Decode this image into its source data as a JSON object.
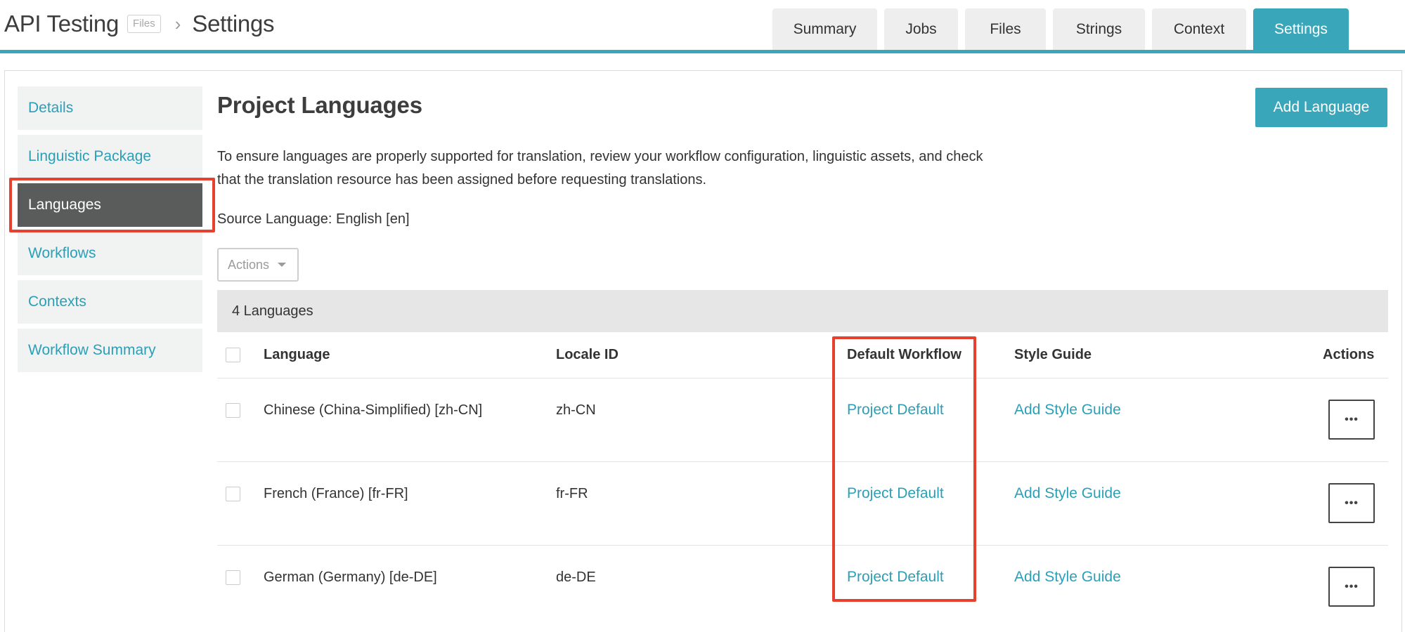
{
  "header": {
    "project_title": "API Testing",
    "project_type_badge": "Files",
    "separator_icon": "chevron-right-icon",
    "page_title": "Settings",
    "tabs": [
      {
        "label": "Summary",
        "active": false
      },
      {
        "label": "Jobs",
        "active": false
      },
      {
        "label": "Files",
        "active": false
      },
      {
        "label": "Strings",
        "active": false
      },
      {
        "label": "Context",
        "active": false
      },
      {
        "label": "Settings",
        "active": true
      }
    ],
    "accent_color": "#3aa6ba"
  },
  "sidebar": {
    "items": [
      {
        "label": "Details",
        "active": false
      },
      {
        "label": "Linguistic Package",
        "active": false
      },
      {
        "label": "Languages",
        "active": true
      },
      {
        "label": "Workflows",
        "active": false
      },
      {
        "label": "Contexts",
        "active": false
      },
      {
        "label": "Workflow Summary",
        "active": false
      }
    ]
  },
  "main": {
    "title": "Project Languages",
    "add_button_label": "Add Language",
    "description": "To ensure languages are properly supported for translation, review your workflow configuration, linguistic assets, and check that the translation resource has been assigned before requesting translations.",
    "source_language": "Source Language: English [en]",
    "actions_dropdown": "Actions",
    "count_label": "4 Languages",
    "table": {
      "columns": [
        "Language",
        "Locale ID",
        "Default Workflow",
        "Style Guide",
        "Actions"
      ],
      "rows": [
        {
          "language": "Chinese (China-Simplified) [zh-CN]",
          "locale": "zh-CN",
          "workflow": "Project Default",
          "style_guide": "Add Style Guide",
          "actions": "•••"
        },
        {
          "language": "French (France) [fr-FR]",
          "locale": "fr-FR",
          "workflow": "Project Default",
          "style_guide": "Add Style Guide",
          "actions": "•••"
        },
        {
          "language": "German (Germany) [de-DE]",
          "locale": "de-DE",
          "workflow": "Project Default",
          "style_guide": "Add Style Guide",
          "actions": "•••"
        }
      ]
    }
  },
  "highlight_color": "#e8402f"
}
